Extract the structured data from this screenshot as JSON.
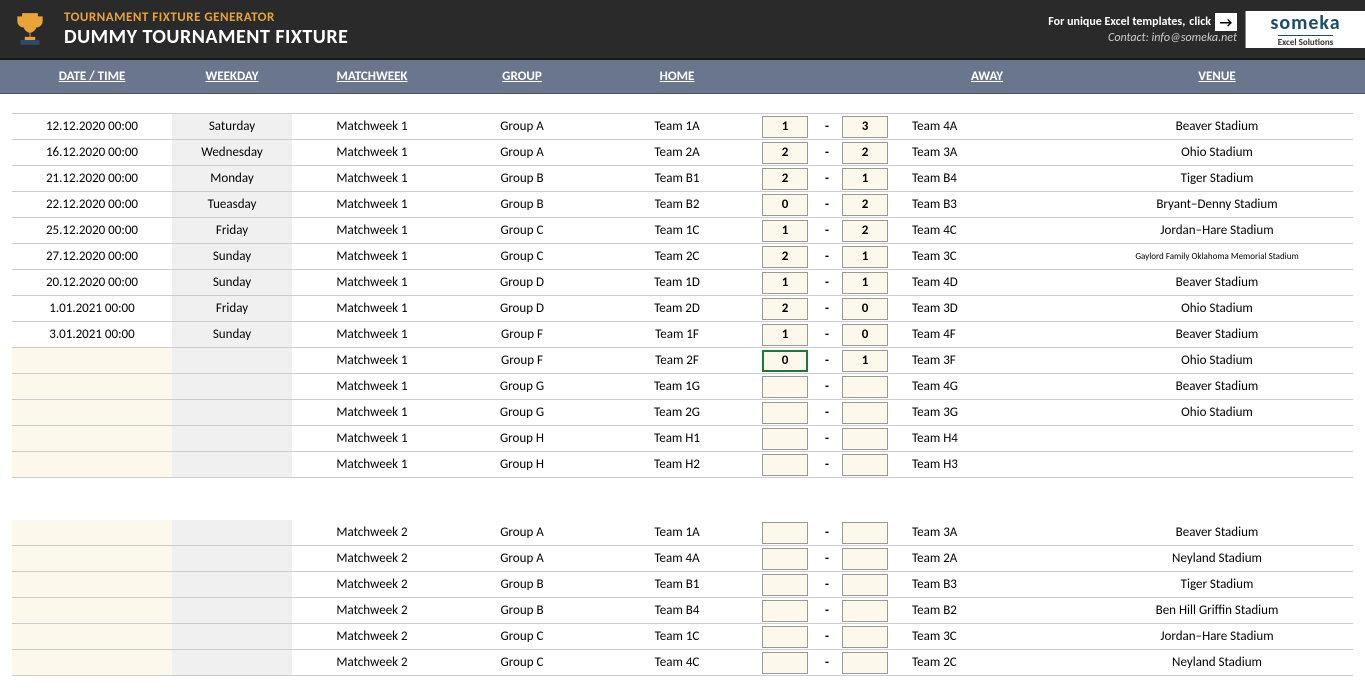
{
  "header": {
    "app_title": "TOURNAMENT FIXTURE GENERATOR",
    "doc_title": "DUMMY TOURNAMENT FIXTURE",
    "click_text": "For unique Excel templates,",
    "click_bold": "click",
    "contact": "Contact: info@someka.net",
    "logo_main": "someka",
    "logo_sub": "Excel Solutions"
  },
  "columns": {
    "date": "DATE / TIME",
    "weekday": "WEEKDAY",
    "matchweek": "MATCHWEEK",
    "group": "GROUP",
    "home": "HOME",
    "away": "AWAY",
    "venue": "VENUE"
  },
  "block1": [
    {
      "date": "12.12.2020 00:00",
      "wd": "Saturday",
      "mw": "Matchweek 1",
      "grp": "Group A",
      "home": "Team 1A",
      "hs": "1",
      "as": "3",
      "away": "Team 4A",
      "ven": "Beaver Stadium"
    },
    {
      "date": "16.12.2020 00:00",
      "wd": "Wednesday",
      "mw": "Matchweek 1",
      "grp": "Group A",
      "home": "Team 2A",
      "hs": "2",
      "as": "2",
      "away": "Team 3A",
      "ven": "Ohio Stadium"
    },
    {
      "date": "21.12.2020 00:00",
      "wd": "Monday",
      "mw": "Matchweek 1",
      "grp": "Group B",
      "home": "Team B1",
      "hs": "2",
      "as": "1",
      "away": "Team B4",
      "ven": "Tiger Stadium"
    },
    {
      "date": "22.12.2020 00:00",
      "wd": "Tueasday",
      "mw": "Matchweek 1",
      "grp": "Group B",
      "home": "Team B2",
      "hs": "0",
      "as": "2",
      "away": "Team B3",
      "ven": "Bryant–Denny Stadium"
    },
    {
      "date": "25.12.2020 00:00",
      "wd": "Friday",
      "mw": "Matchweek 1",
      "grp": "Group C",
      "home": "Team 1C",
      "hs": "1",
      "as": "2",
      "away": "Team 4C",
      "ven": "Jordan–Hare Stadium"
    },
    {
      "date": "27.12.2020 00:00",
      "wd": "Sunday",
      "mw": "Matchweek 1",
      "grp": "Group C",
      "home": "Team 2C",
      "hs": "2",
      "as": "1",
      "away": "Team 3C",
      "ven": "Gaylord Family Oklahoma Memorial Stadium",
      "small": true
    },
    {
      "date": "20.12.2020 00:00",
      "wd": "Sunday",
      "mw": "Matchweek 1",
      "grp": "Group D",
      "home": "Team 1D",
      "hs": "1",
      "as": "1",
      "away": "Team 4D",
      "ven": "Beaver Stadium"
    },
    {
      "date": "1.01.2021 00:00",
      "wd": "Friday",
      "mw": "Matchweek 1",
      "grp": "Group D",
      "home": "Team 2D",
      "hs": "2",
      "as": "0",
      "away": "Team 3D",
      "ven": "Ohio Stadium"
    },
    {
      "date": "3.01.2021 00:00",
      "wd": "Sunday",
      "mw": "Matchweek 1",
      "grp": "Group F",
      "home": "Team 1F",
      "hs": "1",
      "as": "0",
      "away": "Team 4F",
      "ven": "Beaver Stadium"
    },
    {
      "date": "",
      "wd": "",
      "mw": "Matchweek 1",
      "grp": "Group F",
      "home": "Team 2F",
      "hs": "0",
      "as": "1",
      "away": "Team 3F",
      "ven": "Ohio Stadium",
      "sel": true
    },
    {
      "date": "",
      "wd": "",
      "mw": "Matchweek 1",
      "grp": "Group G",
      "home": "Team 1G",
      "hs": "",
      "as": "",
      "away": "Team 4G",
      "ven": "Beaver Stadium"
    },
    {
      "date": "",
      "wd": "",
      "mw": "Matchweek 1",
      "grp": "Group G",
      "home": "Team 2G",
      "hs": "",
      "as": "",
      "away": "Team 3G",
      "ven": "Ohio Stadium"
    },
    {
      "date": "",
      "wd": "",
      "mw": "Matchweek 1",
      "grp": "Group H",
      "home": "Team H1",
      "hs": "",
      "as": "",
      "away": "Team H4",
      "ven": ""
    },
    {
      "date": "",
      "wd": "",
      "mw": "Matchweek 1",
      "grp": "Group H",
      "home": "Team H2",
      "hs": "",
      "as": "",
      "away": "Team H3",
      "ven": ""
    }
  ],
  "block2": [
    {
      "date": "",
      "wd": "",
      "mw": "Matchweek 2",
      "grp": "Group A",
      "home": "Team 1A",
      "hs": "",
      "as": "",
      "away": "Team 3A",
      "ven": "Beaver Stadium"
    },
    {
      "date": "",
      "wd": "",
      "mw": "Matchweek 2",
      "grp": "Group A",
      "home": "Team 4A",
      "hs": "",
      "as": "",
      "away": "Team 2A",
      "ven": "Neyland Stadium"
    },
    {
      "date": "",
      "wd": "",
      "mw": "Matchweek 2",
      "grp": "Group B",
      "home": "Team B1",
      "hs": "",
      "as": "",
      "away": "Team B3",
      "ven": "Tiger Stadium"
    },
    {
      "date": "",
      "wd": "",
      "mw": "Matchweek 2",
      "grp": "Group B",
      "home": "Team B4",
      "hs": "",
      "as": "",
      "away": "Team B2",
      "ven": "Ben Hill Griffin Stadium"
    },
    {
      "date": "",
      "wd": "",
      "mw": "Matchweek 2",
      "grp": "Group C",
      "home": "Team 1C",
      "hs": "",
      "as": "",
      "away": "Team 3C",
      "ven": "Jordan–Hare Stadium"
    },
    {
      "date": "",
      "wd": "",
      "mw": "Matchweek 2",
      "grp": "Group C",
      "home": "Team 4C",
      "hs": "",
      "as": "",
      "away": "Team 2C",
      "ven": "Neyland Stadium"
    }
  ]
}
